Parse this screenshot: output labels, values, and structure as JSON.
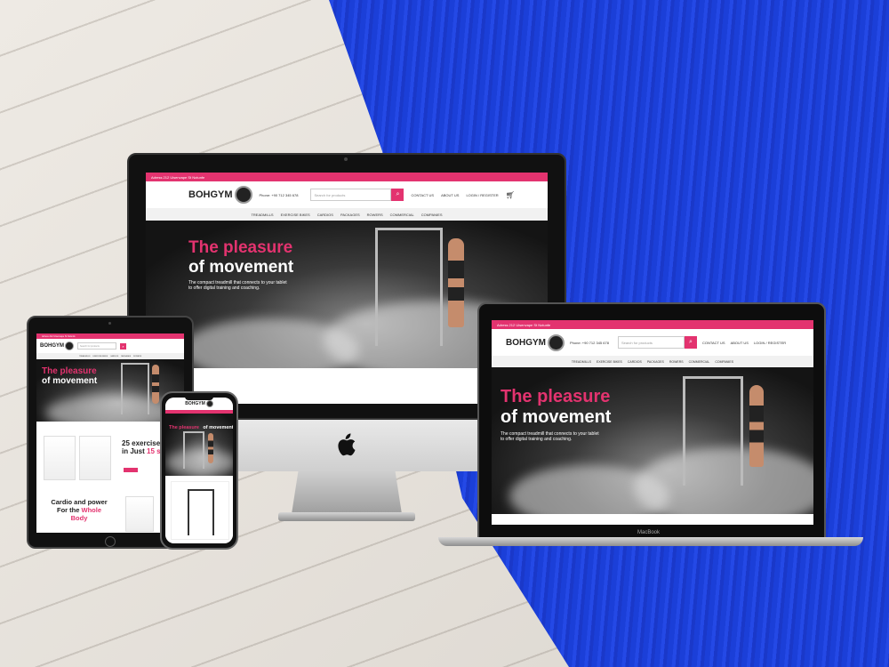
{
  "brand": {
    "name": "BOHGYM",
    "accent": "#e3336f"
  },
  "topbar": {
    "address": "Adress 212 Ulsenvape St Notunfe"
  },
  "header": {
    "phone": "Phone: +90 712 345 678",
    "search_placeholder": "Search for products",
    "links": [
      "CONTACT US",
      "ABOUT US",
      "LOGIN / REGISTER"
    ]
  },
  "nav": [
    "TREADMILLS",
    "EXERCISE BIKES",
    "CARDIOS",
    "PACKAGES",
    "ROWERS",
    "COMMERCIAL",
    "COMPANIES"
  ],
  "hero": {
    "line1": "The pleasure",
    "line2": "of movement",
    "sub1": "The compact treadmill that connects to your tablet",
    "sub2": "to offer digital training and coaching."
  },
  "tablet": {
    "promo1a": "25 exercises",
    "promo1b": "in Just",
    "promo1c": "15 sq",
    "promo2a": "Cardio and power",
    "promo2b": "For the",
    "promo2c": "Whole",
    "promo2d": "Body"
  },
  "laptop": {
    "model": "MacBook"
  }
}
